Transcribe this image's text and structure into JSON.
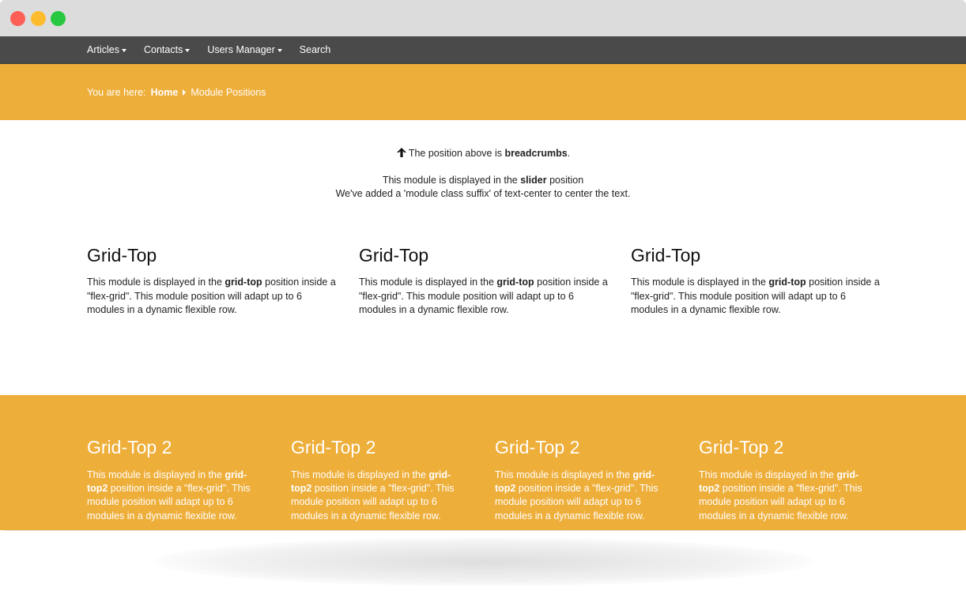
{
  "nav": {
    "items": [
      {
        "label": "Articles",
        "dropdown": true
      },
      {
        "label": "Contacts",
        "dropdown": true
      },
      {
        "label": "Users Manager",
        "dropdown": true
      },
      {
        "label": "Search",
        "dropdown": false
      }
    ]
  },
  "breadcrumb": {
    "prefix": "You are here:",
    "home": "Home",
    "current": "Module Positions"
  },
  "notice": {
    "text_before": "The position above is",
    "bold": "breadcrumbs",
    "text_after": "."
  },
  "slider": {
    "line1_before": "This module is displayed in the",
    "line1_bold": "slider",
    "line1_after": "position",
    "line2": "We've added a 'module class suffix' of text-center to center the text."
  },
  "grid_top": [
    {
      "title": "Grid-Top",
      "before": "This module is displayed in the",
      "bold": "grid-top",
      "after": "position inside a \"flex-grid\". This module position will adapt up to 6 modules in a dynamic flexible row."
    },
    {
      "title": "Grid-Top",
      "before": "This module is displayed in the",
      "bold": "grid-top",
      "after": "position inside a \"flex-grid\". This module position will adapt up to 6 modules in a dynamic flexible row."
    },
    {
      "title": "Grid-Top",
      "before": "This module is displayed in the",
      "bold": "grid-top",
      "after": "position inside a \"flex-grid\". This module position will adapt up to 6 modules in a dynamic flexible row."
    }
  ],
  "grid_top2": [
    {
      "title": "Grid-Top 2",
      "before": "This module is displayed in the",
      "bold": "grid-top2",
      "after": "position inside a \"flex-grid\". This module position will adapt up to 6 modules in a dynamic flexible row."
    },
    {
      "title": "Grid-Top 2",
      "before": "This module is displayed in the",
      "bold": "grid-top2",
      "after": "position inside a \"flex-grid\". This module position will adapt up to 6 modules in a dynamic flexible row."
    },
    {
      "title": "Grid-Top 2",
      "before": "This module is displayed in the",
      "bold": "grid-top2",
      "after": "position inside a \"flex-grid\". This module position will adapt up to 6 modules in a dynamic flexible row."
    },
    {
      "title": "Grid-Top 2",
      "before": "This module is displayed in the",
      "bold": "grid-top2",
      "after": "position inside a \"flex-grid\". This module position will adapt up to 6 modules in a dynamic flexible row."
    }
  ],
  "colors": {
    "accent": "#eeae3a",
    "navbar": "#4a4a4a",
    "titlebar": "#dcdcdc"
  },
  "icons": {
    "window_close": "close-dot-icon",
    "window_minimize": "minimize-dot-icon",
    "window_zoom": "zoom-dot-icon",
    "dropdown": "caret-down-icon",
    "breadcrumb_separator": "caret-right-icon",
    "notice": "arrow-up-icon"
  }
}
